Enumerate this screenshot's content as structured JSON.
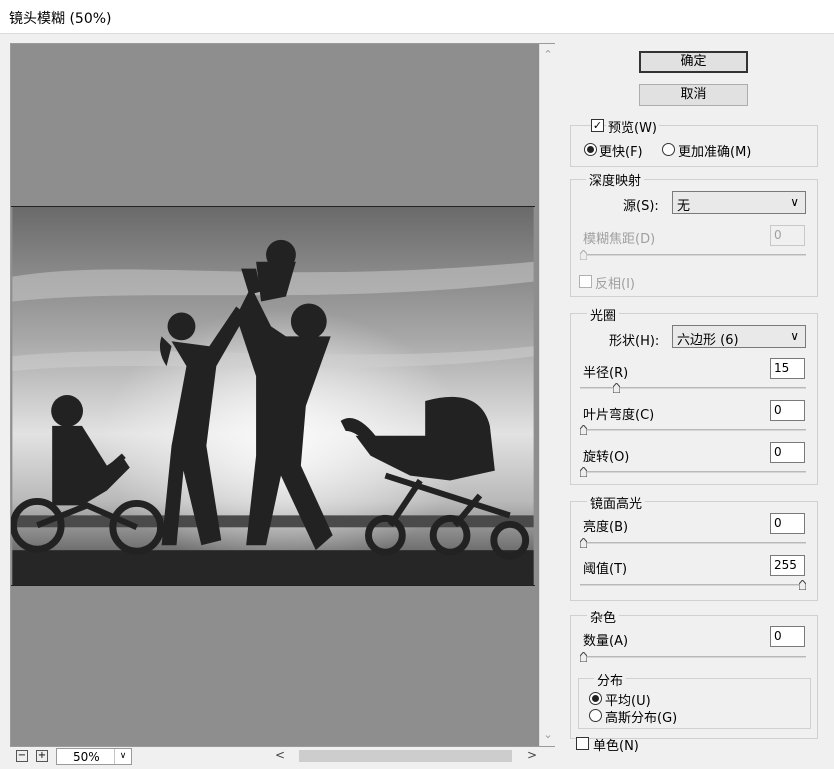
{
  "window": {
    "title": "镜头模糊 (50%)"
  },
  "preview": {
    "zoom": "50%"
  },
  "buttons": {
    "ok": "确定",
    "cancel": "取消"
  },
  "preview_opts": {
    "preview_label": "预览(W)",
    "preview_checked": true,
    "faster": "更快(F)",
    "more_accurate": "更加准确(M)"
  },
  "depth_map": {
    "title": "深度映射",
    "source_label": "源(S):",
    "source_value": "无",
    "focal_label": "模糊焦距(D)",
    "focal_value": "0",
    "invert_label": "反相(I)"
  },
  "iris": {
    "title": "光圈",
    "shape_label": "形状(H):",
    "shape_value": "六边形 (6)",
    "radius_label": "半径(R)",
    "radius_value": "15",
    "curvature_label": "叶片弯度(C)",
    "curvature_value": "0",
    "rotation_label": "旋转(O)",
    "rotation_value": "0"
  },
  "specular": {
    "title": "镜面高光",
    "brightness_label": "亮度(B)",
    "brightness_value": "0",
    "threshold_label": "阈值(T)",
    "threshold_value": "255"
  },
  "noise": {
    "title": "杂色",
    "amount_label": "数量(A)",
    "amount_value": "0",
    "dist_title": "分布",
    "uniform": "平均(U)",
    "gaussian": "高斯分布(G)",
    "mono": "单色(N)"
  }
}
